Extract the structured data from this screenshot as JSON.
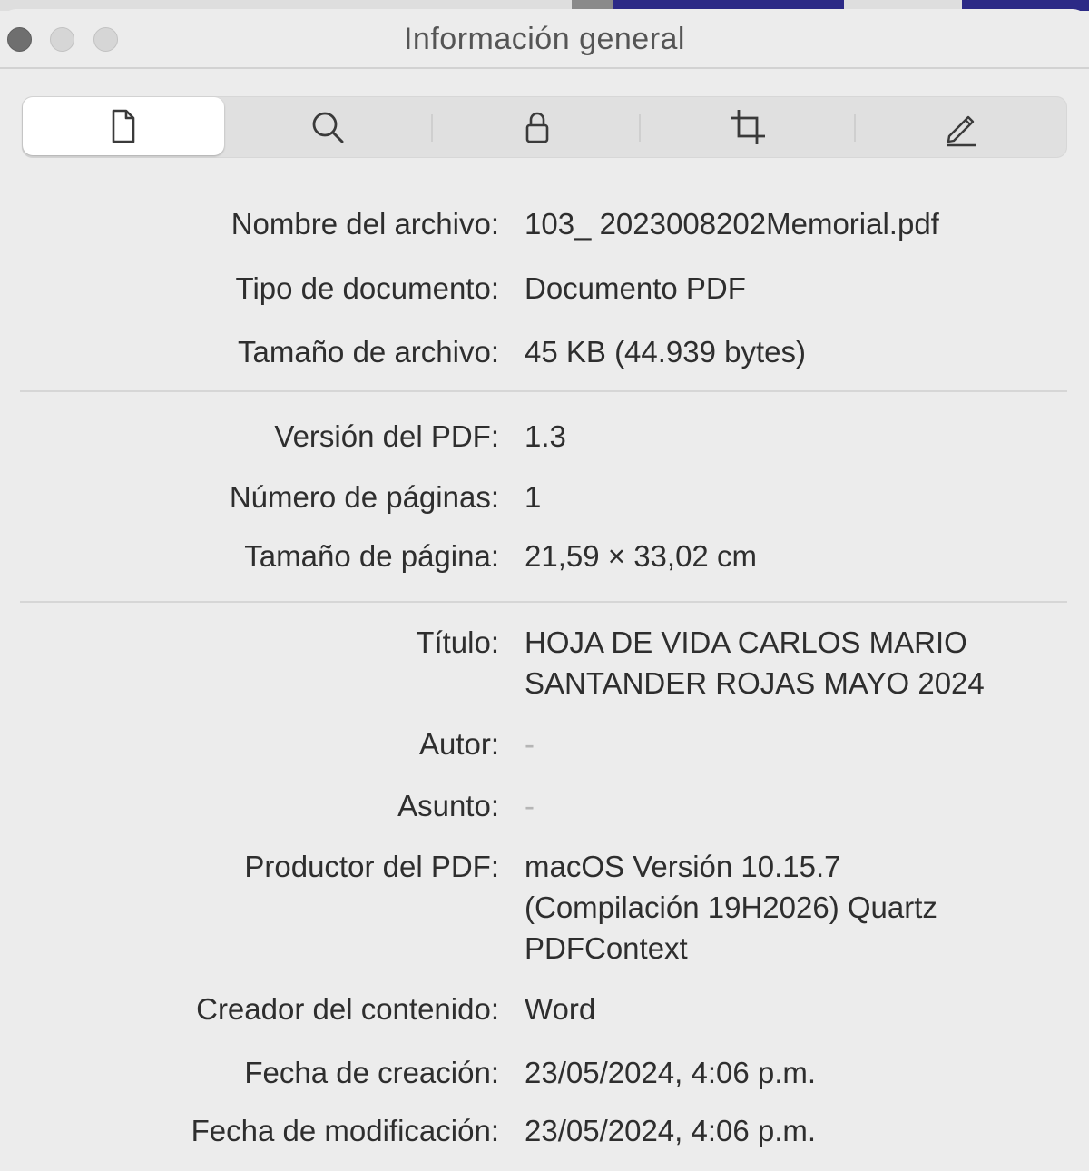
{
  "window": {
    "title": "Información general"
  },
  "toolbar": {
    "tabs": [
      {
        "id": "general",
        "icon": "document-icon",
        "active": true
      },
      {
        "id": "search",
        "icon": "magnifier-icon",
        "active": false
      },
      {
        "id": "security",
        "icon": "lock-icon",
        "active": false
      },
      {
        "id": "crop",
        "icon": "crop-icon",
        "active": false
      },
      {
        "id": "annotate",
        "icon": "pencil-icon",
        "active": false
      }
    ]
  },
  "file_section": {
    "file_name_label": "Nombre del archivo:",
    "file_name": "103_ 2023008202Memorial.pdf",
    "doc_type_label": "Tipo de documento:",
    "doc_type": "Documento PDF",
    "file_size_label": "Tamaño de archivo:",
    "file_size": "45 KB (44.939 bytes)"
  },
  "pdf_section": {
    "version_label": "Versión del PDF:",
    "version": "1.3",
    "pages_label": "Número de páginas:",
    "pages": "1",
    "page_size_label": "Tamaño de página:",
    "page_size": "21,59 × 33,02 cm"
  },
  "meta_section": {
    "title_label": "Título:",
    "title": "HOJA DE VIDA CARLOS MARIO SANTANDER ROJAS MAYO 2024",
    "author_label": "Autor:",
    "author": "-",
    "subject_label": "Asunto:",
    "subject": "-",
    "producer_label": "Productor del PDF:",
    "producer": "macOS Versión 10.15.7 (Compilación 19H2026) Quartz PDFContext",
    "creator_label": "Creador del contenido:",
    "creator": "Word",
    "created_label": "Fecha de creación:",
    "created": "23/05/2024, 4:06 p.m.",
    "modified_label": "Fecha de modificación:",
    "modified": "23/05/2024, 4:06 p.m."
  }
}
